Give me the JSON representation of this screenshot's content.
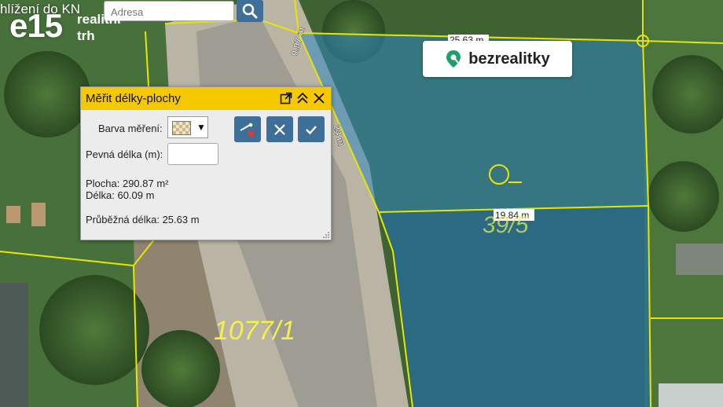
{
  "header": {
    "title_partial": "hlížení do KN",
    "search": {
      "placeholder": "Adresa",
      "value": ""
    },
    "search_icon": "search-icon"
  },
  "logo": {
    "brand": "e15",
    "line1": "realitní",
    "line2": "trh"
  },
  "badge": {
    "label": "bezrealitky",
    "icon": "location-pin-icon",
    "accent": "#1f9e6e"
  },
  "map_labels": {
    "parcel_main": "1077/1",
    "parcel_right": "39/5",
    "dimension_top": "25.63 m",
    "dimension_bottom": "19.84 m",
    "dimension_left": "0.97 m",
    "dimension_road": "24 m"
  },
  "colors": {
    "parcel_line": "#e8e600",
    "measure_fill": "#2e86c1",
    "panel_header": "#f5c800",
    "button": "#3e6f99"
  },
  "panel": {
    "title": "Měřit délky-plochy",
    "header_icons": [
      "popout-icon",
      "collapse-icon",
      "close-icon"
    ],
    "color_label": "Barva měření:",
    "fixed_length_label": "Pevná délka (m):",
    "fixed_length_value": "",
    "buttons": [
      "remove-measure-icon",
      "cancel-icon",
      "confirm-icon"
    ],
    "area": "Plocha: 290.87 m²",
    "length": "Délka: 60.09 m",
    "running_length": "Průběžná délka: 25.63 m"
  }
}
